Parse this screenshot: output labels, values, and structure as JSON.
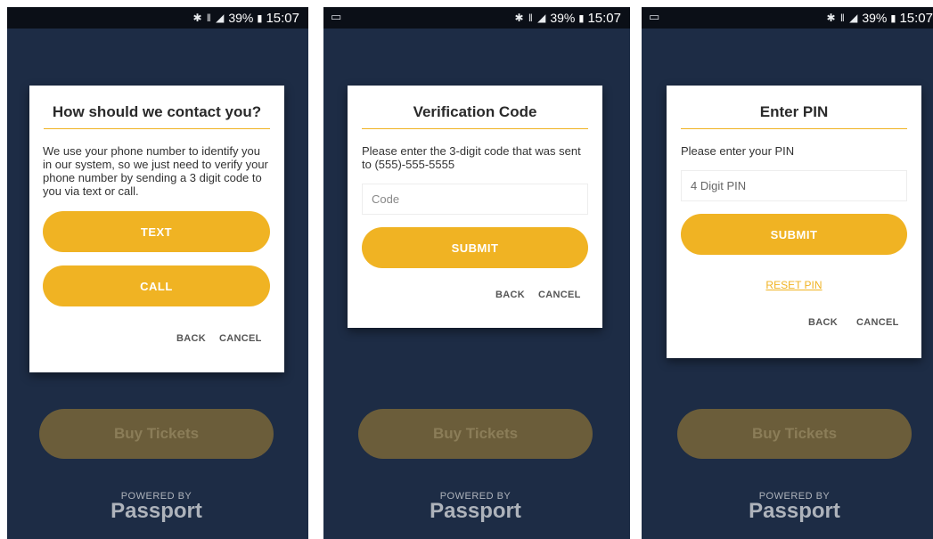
{
  "status_bar": {
    "battery": "39%",
    "time": "15:07",
    "icons": "bluetooth-icon signal-icon battery-icon"
  },
  "screens": [
    {
      "dialog": {
        "title": "How should we contact you?",
        "body": "We use your phone number to identify you in our system, so we just need to verify your phone number by sending a 3 digit code to you via text or call.",
        "buttons": [
          "TEXT",
          "CALL"
        ],
        "back": "BACK",
        "cancel": "CANCEL"
      }
    },
    {
      "dialog": {
        "title": "Verification Code",
        "body": "Please enter the 3-digit code that was sent to (555)-555-5555",
        "input_placeholder": "Code",
        "submit": "SUBMIT",
        "back": "BACK",
        "cancel": "CANCEL"
      }
    },
    {
      "dialog": {
        "title": "Enter PIN",
        "body": "Please enter your PIN",
        "input_placeholder": "4 Digit PIN",
        "submit": "SUBMIT",
        "reset": "RESET PIN",
        "back": "BACK",
        "cancel": "CANCEL"
      }
    }
  ],
  "background": {
    "buy_button": "Buy Tickets",
    "powered_by": "POWERED BY",
    "brand": "Passport"
  },
  "colors": {
    "accent": "#f0b323",
    "background": "#1d2c45",
    "dialog": "#ffffff"
  }
}
